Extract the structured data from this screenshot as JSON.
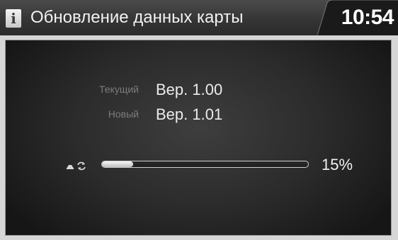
{
  "header": {
    "info_icon": "i",
    "title": "Обновление данных карты",
    "clock": "10:54"
  },
  "versions": {
    "current_label": "Текущий",
    "current_value": "Вер. 1.00",
    "new_label": "Новый",
    "new_value": "Вер. 1.01"
  },
  "progress": {
    "icon": "map-sync-icon",
    "fraction": 0.15,
    "percent_text": "15%"
  },
  "colors": {
    "titlebar": "#353535",
    "panel": "#2b2b2b",
    "text": "#ececec",
    "label": "#7c7c7c"
  }
}
